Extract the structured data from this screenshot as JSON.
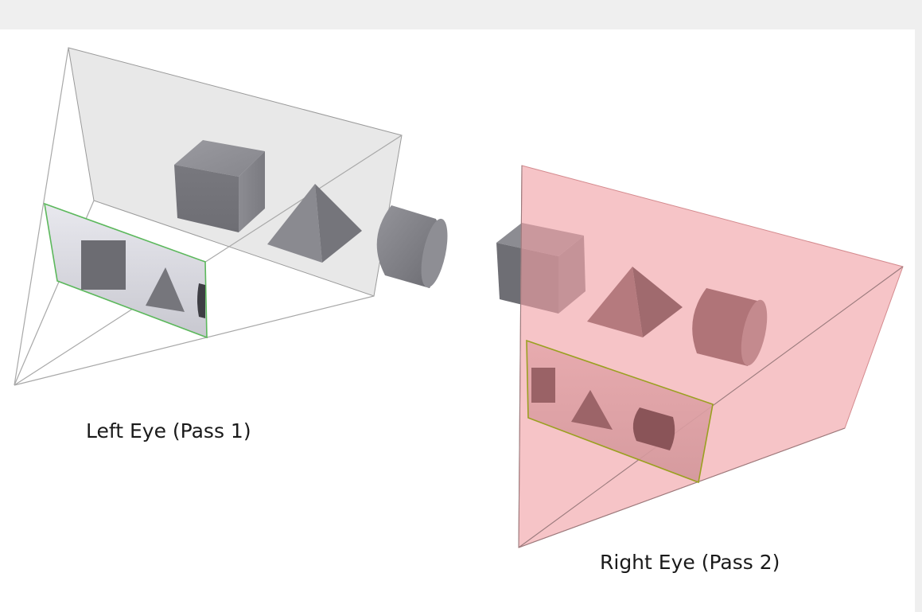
{
  "captions": {
    "left": "Left Eye (Pass 1)",
    "right": "Right Eye (Pass 2)"
  },
  "colors": {
    "left_frustum_fill": "#e4e4e4",
    "right_frustum_fill": "#f0a0a4",
    "left_near_plane_border": "#5cb85c",
    "right_near_plane_border": "#9aa020",
    "object_gray": "#7c7c82",
    "frustum_line": "#9a9a9a"
  },
  "scene_objects": [
    "cube",
    "pyramid",
    "cylinder"
  ]
}
